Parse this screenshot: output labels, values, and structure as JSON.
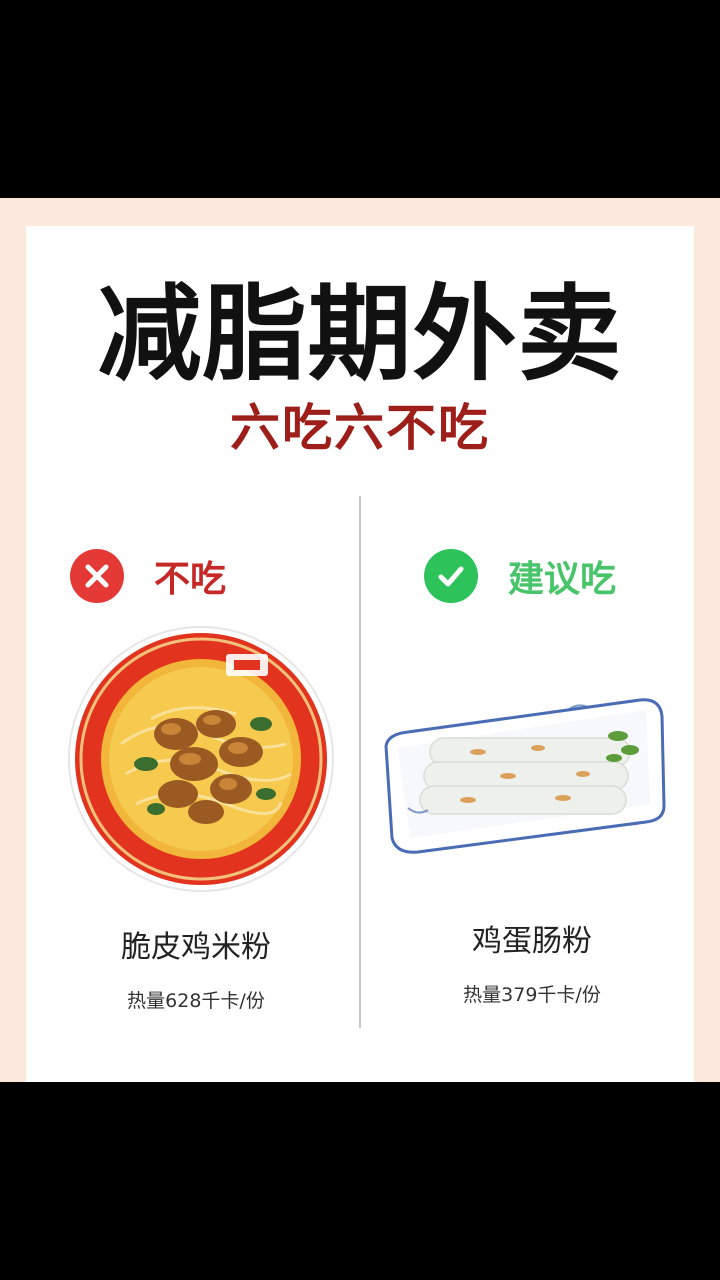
{
  "title": "减脂期外卖",
  "subtitle": "六吃六不吃",
  "colors": {
    "title": "#111111",
    "subtitle": "#9e1f1a",
    "no_badge": "#e53935",
    "yes_badge": "#2ec35a",
    "no_label": "#c62828",
    "yes_label": "#48c46a",
    "background_frame": "#fbe9de"
  },
  "left": {
    "tag_icon": "x-circle-icon",
    "tag_label": "不吃",
    "food_icon": "noodle-bowl-image",
    "food_name": "脆皮鸡米粉",
    "calories": "热量628千卡/份"
  },
  "right": {
    "tag_icon": "check-circle-icon",
    "tag_label": "建议吃",
    "food_icon": "rice-noodle-roll-image",
    "food_name": "鸡蛋肠粉",
    "calories": "热量379千卡/份"
  }
}
